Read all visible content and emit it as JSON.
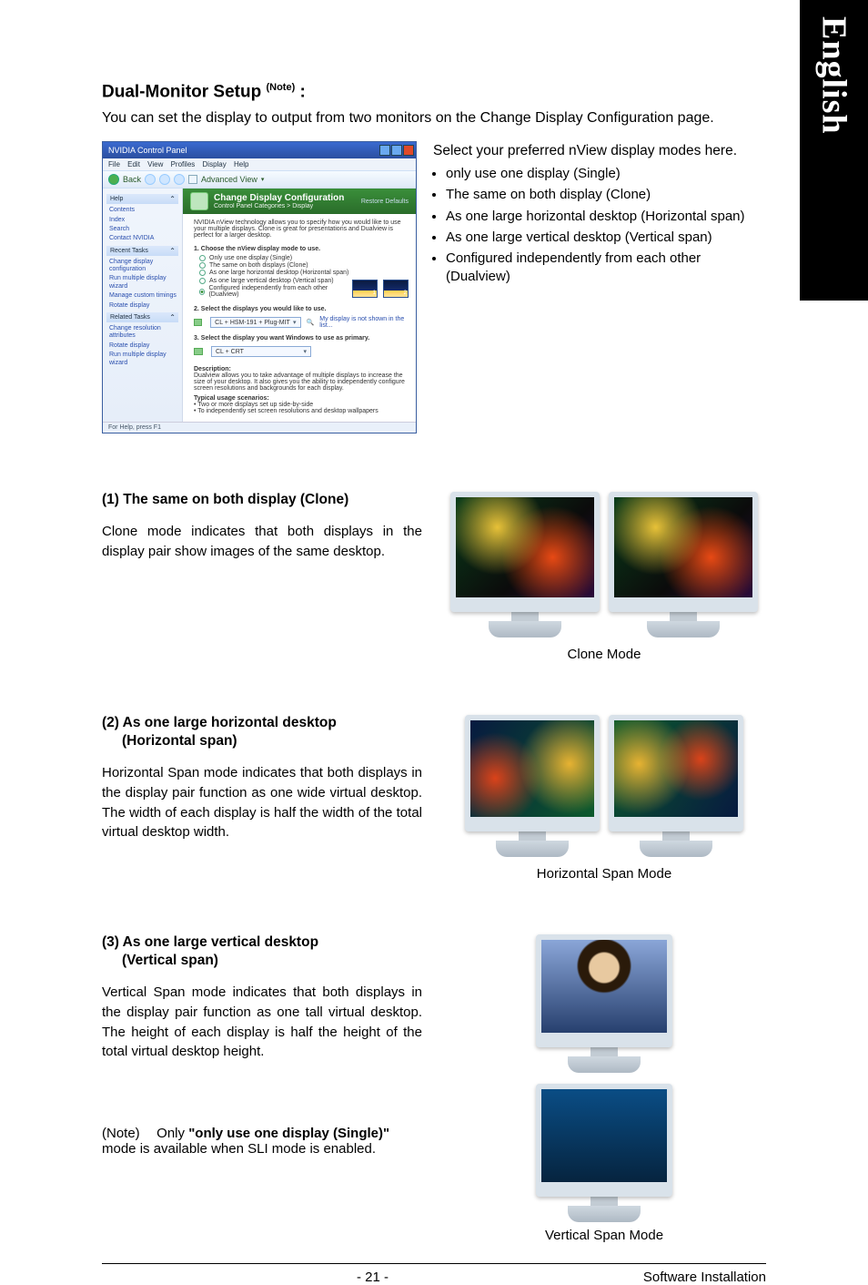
{
  "sideTab": "English",
  "title": {
    "main": "Dual-Monitor Setup",
    "note_sup": "(Note)",
    "suffix": " :"
  },
  "intro": "You can set the display to output from two monitors on the Change Display Configuration page.",
  "window": {
    "title": "NVIDIA Control Panel",
    "menus": [
      "File",
      "Edit",
      "View",
      "Profiles",
      "Display",
      "Help"
    ],
    "toolbar": {
      "back": "Back",
      "advanced": "Advanced View"
    },
    "sidebar": {
      "g1": {
        "head": "Help",
        "items": [
          "Contents",
          "Index",
          "Search",
          "Contact NVIDIA"
        ]
      },
      "g2": {
        "head": "Recent Tasks",
        "items": [
          "Change display configuration",
          "Run multiple display wizard",
          "Manage custom timings",
          "Rotate display"
        ]
      },
      "g3": {
        "head": "Related Tasks",
        "items": [
          "Change resolution attributes",
          "Rotate display",
          "Run multiple display wizard"
        ]
      }
    },
    "header": {
      "title": "Change Display Configuration",
      "crumbs": "Control Panel Categories > Display",
      "restore": "Restore Defaults"
    },
    "body": {
      "desc": "NVIDIA nView technology allows you to specify how you would like to use your multiple displays. Clone is great for presentations and Dualview is perfect for a larger desktop.",
      "sec1": "1. Choose the nView display mode to use.",
      "r1": "Only use one display (Single)",
      "r2": "The same on both displays (Clone)",
      "r3": "As one large horizontal desktop (Horizontal span)",
      "r4": "As one large vertical desktop (Vertical span)",
      "r5": "Configured independently from each other (Dualview)",
      "sec2": "2. Select the displays you would like to use.",
      "drop1": "CL + HSM-191 + Plug-MIT",
      "hint": "My display is not shown in the list...",
      "sec3": "3. Select the display you want Windows to use as primary.",
      "drop2": "CL + CRT",
      "descHead": "Description:",
      "descBody": "Dualview allows you to take advantage of multiple displays to increase the size of your desktop. It also gives you the ability to independently configure screen resolutions and backgrounds for each display.",
      "scHead": "Typical usage scenarios:",
      "sc1": "• Two or more displays set up side-by-side",
      "sc2": "• To independently set screen resolutions and desktop wallpapers"
    },
    "status": "For Help, press F1"
  },
  "nvTitle": "Select your preferred nView display modes here.",
  "modes": [
    "only use one display (Single)",
    "The same on both display (Clone)",
    "As one large horizontal desktop (Horizontal span)",
    "As one large vertical desktop (Vertical span)",
    "Configured independently from each other (Dualview)"
  ],
  "sections": {
    "s1": {
      "head": "(1) The same on both display (Clone)",
      "body": "Clone mode indicates that both displays in the display pair show images of the same desktop.",
      "caption": "Clone Mode"
    },
    "s2": {
      "head1": "(2) As one large horizontal desktop",
      "head2": "(Horizontal span)",
      "body": "Horizontal Span mode indicates that both displays in the display pair function as one wide virtual desktop. The width of each display is half the width of the total virtual desktop width.",
      "caption": "Horizontal Span Mode"
    },
    "s3": {
      "head1": "(3) As one large vertical desktop",
      "head2": "(Vertical span)",
      "body": "Vertical Span mode indicates that both displays in the display pair function as one tall virtual desktop. The height of each display is half the height of the total virtual desktop height.",
      "caption": "Vertical Span Mode"
    }
  },
  "note": {
    "label": "(Note)",
    "pre": "Only ",
    "bold": "\"only use one display (Single)\"",
    "post": " mode is available when SLI mode is enabled."
  },
  "footer": {
    "page": "- 21 -",
    "section": "Software Installation"
  }
}
